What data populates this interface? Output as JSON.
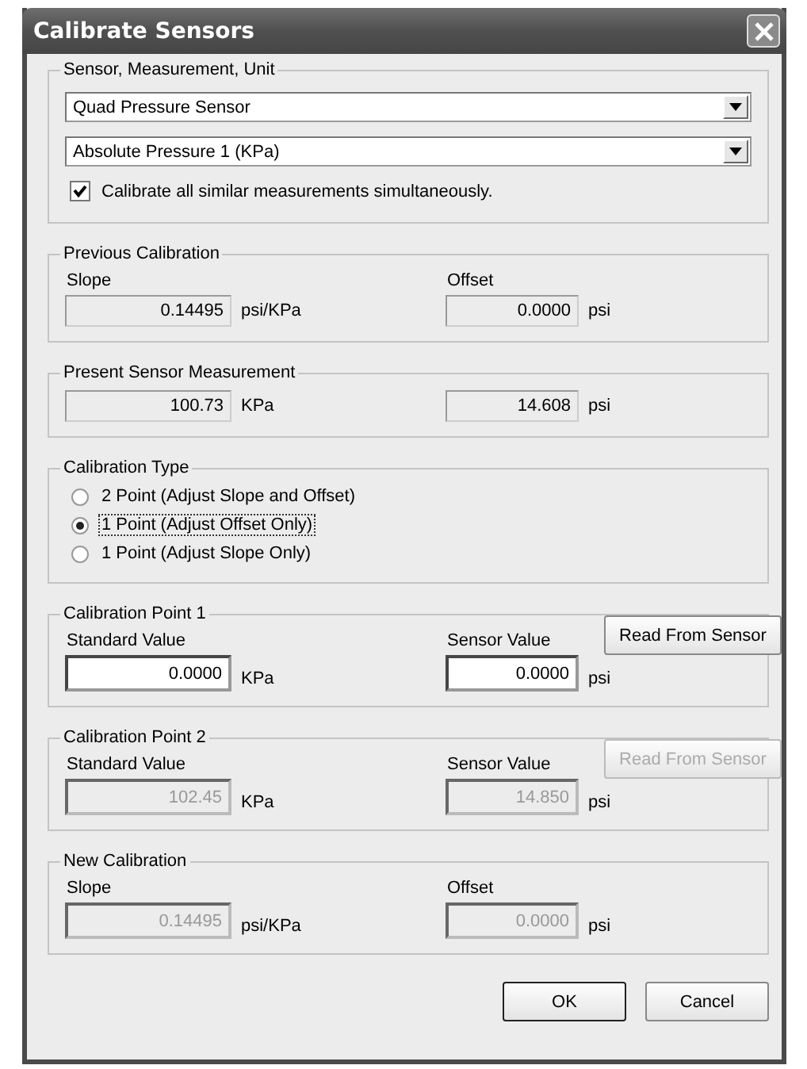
{
  "window": {
    "title": "Calibrate Sensors"
  },
  "sections": [
    {
      "kind": "selection",
      "title": "Sensor, Measurement, Unit",
      "dropdowns": [
        {
          "value": "Quad Pressure Sensor"
        },
        {
          "value": "Absolute Pressure 1 (KPa)"
        }
      ],
      "checkbox": {
        "label": "Calibrate all similar measurements simultaneously.",
        "checked": true
      }
    },
    {
      "kind": "values",
      "title": "Previous Calibration",
      "fields": [
        {
          "label": "Slope",
          "value": "0.14495",
          "unit": "psi/KPa",
          "editable": false,
          "disabled": false
        },
        {
          "label": "Offset",
          "value": "0.0000",
          "unit": "psi",
          "editable": false,
          "disabled": false
        }
      ]
    },
    {
      "kind": "values",
      "title": "Present Sensor Measurement",
      "fields": [
        {
          "value": "100.73",
          "unit": "KPa",
          "editable": false,
          "disabled": false
        },
        {
          "value": "14.608",
          "unit": "psi",
          "editable": false,
          "disabled": false
        }
      ]
    },
    {
      "kind": "radios",
      "title": "Calibration Type",
      "options": [
        {
          "label": "2 Point (Adjust Slope and Offset)",
          "selected": false
        },
        {
          "label": "1 Point (Adjust Offset Only)",
          "selected": true
        },
        {
          "label": "1 Point (Adjust Slope Only)",
          "selected": false
        }
      ]
    },
    {
      "kind": "values",
      "title": "Calibration Point 1",
      "fields": [
        {
          "label": "Standard Value",
          "value": "0.0000",
          "unit": "KPa",
          "editable": true,
          "disabled": false
        },
        {
          "label": "Sensor Value",
          "value": "0.0000",
          "unit": "psi",
          "editable": true,
          "disabled": false
        }
      ],
      "button": {
        "label": "Read From Sensor",
        "disabled": false
      }
    },
    {
      "kind": "values",
      "title": "Calibration Point 2",
      "fields": [
        {
          "label": "Standard Value",
          "value": "102.45",
          "unit": "KPa",
          "editable": false,
          "disabled": true
        },
        {
          "label": "Sensor Value",
          "value": "14.850",
          "unit": "psi",
          "editable": false,
          "disabled": true
        }
      ],
      "button": {
        "label": "Read From Sensor",
        "disabled": true
      }
    },
    {
      "kind": "values",
      "title": "New Calibration",
      "fields": [
        {
          "label": "Slope",
          "value": "0.14495",
          "unit": "psi/KPa",
          "editable": false,
          "disabled": true
        },
        {
          "label": "Offset",
          "value": "0.0000",
          "unit": "psi",
          "editable": false,
          "disabled": true
        }
      ]
    }
  ],
  "buttons": [
    {
      "label": "OK",
      "default": true
    },
    {
      "label": "Cancel",
      "default": false
    }
  ]
}
